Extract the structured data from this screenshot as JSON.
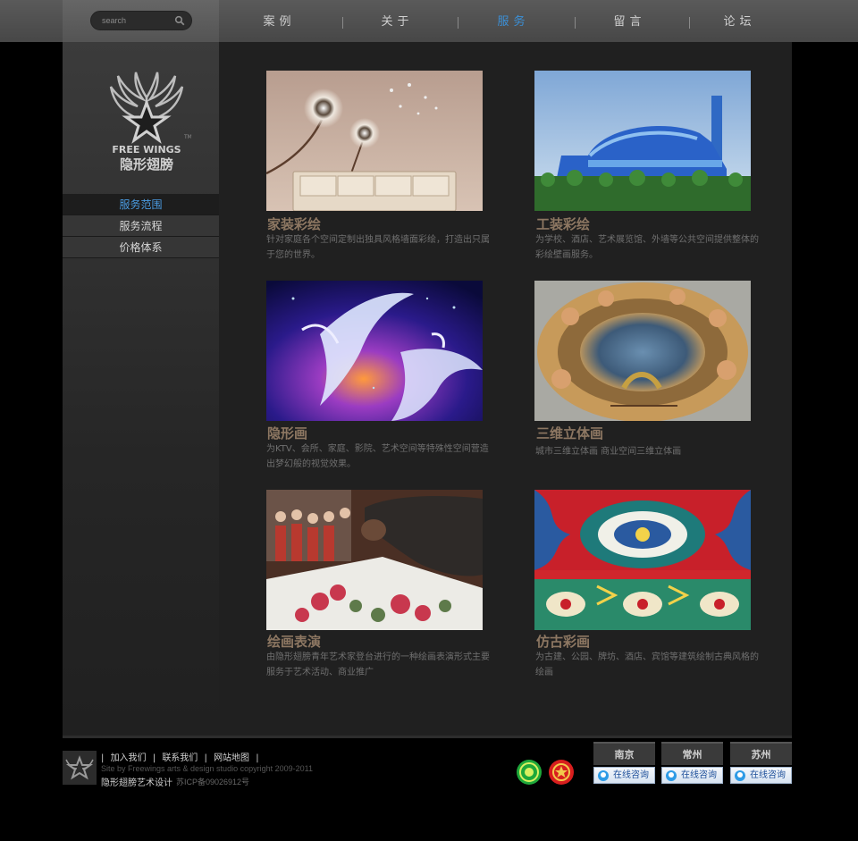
{
  "search": {
    "placeholder": "search"
  },
  "nav": [
    {
      "label": "案例"
    },
    {
      "label": "关于"
    },
    {
      "label": "服务"
    },
    {
      "label": "留言"
    },
    {
      "label": "论坛"
    }
  ],
  "logo": {
    "text": "FREE WINGS",
    "cn": "隐形翅膀",
    "tm": "TM"
  },
  "sidebar": [
    {
      "label": "服务范围"
    },
    {
      "label": "服务流程"
    },
    {
      "label": "价格体系"
    }
  ],
  "cards": [
    {
      "title": "家装彩绘",
      "desc": "针对家庭各个空间定制出独具风格墙面彩绘，打造出只属于您的世界。"
    },
    {
      "title": "工装彩绘",
      "desc": "为学校、酒店、艺术展览馆、外墙等公共空间提供整体的彩绘壁画服务。"
    },
    {
      "title": "隐形画",
      "desc": "为KTV、会所、家庭、影院、艺术空间等特殊性空间营造出梦幻般的视觉效果。"
    },
    {
      "title": "三维立体画",
      "desc": "城市三维立体画  商业空间三维立体画"
    },
    {
      "title": "绘画表演",
      "desc": "由隐形翅膀青年艺术家登台进行的一种绘画表演形式主要服务于艺术活动、商业推广"
    },
    {
      "title": "仿古彩画",
      "desc": "为古建、公园、牌坊、酒店、宾馆等建筑绘制古典风格的绘画"
    }
  ],
  "footer": {
    "links": [
      "加入我们",
      "联系我们",
      "网站地图"
    ],
    "copyright": "Site by Freewings arts & design studio copyright 2009-2011",
    "company": "隐形翅膀艺术设计",
    "icp": "苏ICP备09026912号",
    "cities": [
      {
        "name": "南京",
        "consult": "在线咨询"
      },
      {
        "name": "常州",
        "consult": "在线咨询"
      },
      {
        "name": "苏州",
        "consult": "在线咨询"
      }
    ]
  }
}
